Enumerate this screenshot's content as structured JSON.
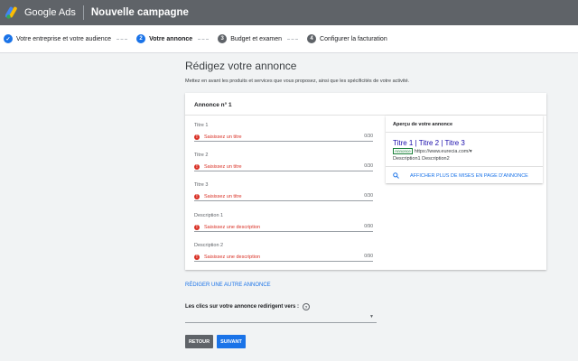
{
  "header": {
    "brand": "Google Ads",
    "campaign": "Nouvelle campagne"
  },
  "steps": [
    {
      "num": "✓",
      "label": "Votre entreprise et votre audience"
    },
    {
      "num": "2",
      "label": "Votre annonce"
    },
    {
      "num": "3",
      "label": "Budget et examen"
    },
    {
      "num": "4",
      "label": "Configurer la facturation"
    }
  ],
  "page": {
    "title": "Rédigez votre annonce",
    "subtitle": "Mettez en avant les produits et services que vous proposez, ainsi que les spécificités de votre activité."
  },
  "card": {
    "heading": "Annonce n° 1",
    "fields": [
      {
        "label": "Titre 1",
        "error": "Saisissez un titre",
        "count": "0/30"
      },
      {
        "label": "Titre 2",
        "error": "Saisissez un titre",
        "count": "0/30"
      },
      {
        "label": "Titre 3",
        "error": "Saisissez un titre",
        "count": "0/30"
      },
      {
        "label": "Description 1",
        "error": "Saisissez une description",
        "count": "0/90"
      },
      {
        "label": "Description 2",
        "error": "Saisissez une description",
        "count": "0/90"
      }
    ]
  },
  "preview": {
    "heading": "Aperçu de votre annonce",
    "ad_title": "Titre 1 | Titre 2 | Titre 3",
    "badge": "Annonce",
    "url": "https://www.eurecia.com/",
    "description": "Description1 Description2",
    "more": "AFFICHER PLUS DE MISES EN PAGE D'ANNONCE"
  },
  "another_ad": "RÉDIGER UNE AUTRE ANNONCE",
  "redirect_label": "Les clics sur votre annonce redirigent vers :",
  "buttons": {
    "back": "RETOUR",
    "next": "SUIVANT"
  },
  "colors": {
    "accent": "#1a73e8",
    "error": "#d93025",
    "topbar": "#5f6368"
  },
  "icons": {
    "logo": "google-ads-logo",
    "check": "check-icon",
    "error": "error-icon",
    "search": "search-icon",
    "help": "help-icon"
  }
}
